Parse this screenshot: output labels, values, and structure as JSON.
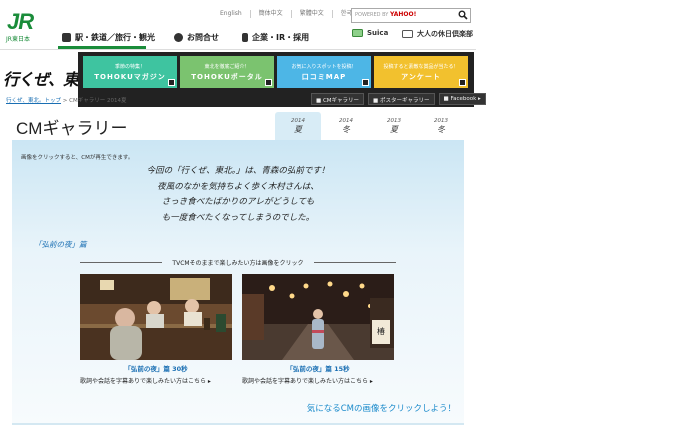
{
  "header": {
    "logo_sub": "JR東日本",
    "languages": [
      "English",
      "簡体中文",
      "繁體中文",
      "한국어"
    ],
    "search_placeholder": "POWERED BY",
    "search_brand": "YAHOO!",
    "nav": [
      "駅・鉄道／旅行・観光",
      "お問合せ",
      "企業・IR・採用"
    ],
    "suica": "Suica",
    "holiday": "大人の休日倶楽部"
  },
  "campaign": {
    "logo": "行くぜ、東北。",
    "promos": [
      {
        "sub": "季節の特集！",
        "title": "TOHOKUマガジン",
        "color": "#3ec4a0"
      },
      {
        "sub": "東北を徹底ご紹介！",
        "title": "TOHOKUポータル",
        "color": "#7bc36f"
      },
      {
        "sub": "お気に入りスポットを投稿！",
        "title": "口コミMAP",
        "color": "#4db6e6"
      },
      {
        "sub": "投稿すると素敵な賞品が当たる！",
        "title": "アンケート",
        "color": "#f2c12e"
      }
    ],
    "sublinks": [
      "CMギャラリー",
      "ポスターギャラリー",
      "Facebook"
    ]
  },
  "breadcrumb": {
    "items": [
      "行くぜ、東北。トップ",
      "CMギャラリー",
      "2014夏"
    ],
    "sep": ">"
  },
  "gallery": {
    "title": "CMギャラリー",
    "tabs": [
      {
        "year": "2014",
        "season": "夏"
      },
      {
        "year": "2014",
        "season": "冬"
      },
      {
        "year": "2013",
        "season": "夏"
      },
      {
        "year": "2013",
        "season": "冬"
      }
    ],
    "active_tab": 0
  },
  "main": {
    "note": "画像をクリックすると、CMが再生できます。",
    "copy_lines": [
      "今回の「行くぜ、東北。」は、青森の弘前です！",
      "夜風のなかを気持ちよく歩く木村さんは、",
      "さっき食べたばかりのアレがどうしても",
      "も一度食べたくなってしまうのでした。"
    ],
    "episode": "「弘前の夜」篇",
    "tvcm_label": "TVCMそのままで楽しみたい方は画像をクリック",
    "videos": [
      {
        "caption": "「弘前の夜」篇 30秒",
        "link": "歌詞や会話を字幕ありで楽しみたい方はこちら"
      },
      {
        "caption": "「弘前の夜」篇 15秒",
        "link": "歌詞や会話を字幕ありで楽しみたい方はこちら"
      }
    ],
    "cta": "気になるCMの画像をクリックしよう！"
  },
  "colors": {
    "brand_green": "#1a8c3a",
    "link_blue": "#1a6fb3",
    "panel_blue": "#cbe6f4"
  }
}
